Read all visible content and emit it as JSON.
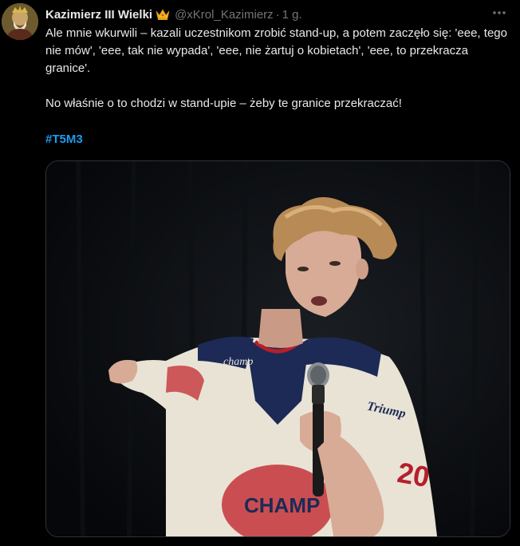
{
  "author": {
    "display_name": "Kazimierz III Wielki",
    "badge_icon": "crown-icon",
    "handle": "@xKrol_Kazimierz",
    "separator": "·",
    "time": "1 g."
  },
  "tweet": {
    "paragraph_1": "Ale mnie wkurwili – kazali uczestnikom zrobić stand-up, a potem zaczęło się: 'eee, tego nie mów', 'eee, tak nie wypada', 'eee, nie żartuj o kobietach', 'eee, to przekracza granice'.",
    "paragraph_2": "No właśnie o to chodzi w stand-upie – żeby te granice przekraczać!",
    "hashtag": "#T5M3"
  },
  "media": {
    "jersey_text_left": "champ",
    "jersey_text_right": "Triump",
    "jersey_text_center": "CHAMP",
    "jersey_number": "20"
  },
  "colors": {
    "background": "#000000",
    "text": "#e7e9ea",
    "muted": "#71767b",
    "link": "#1d9bf0",
    "border": "#2f3336"
  }
}
